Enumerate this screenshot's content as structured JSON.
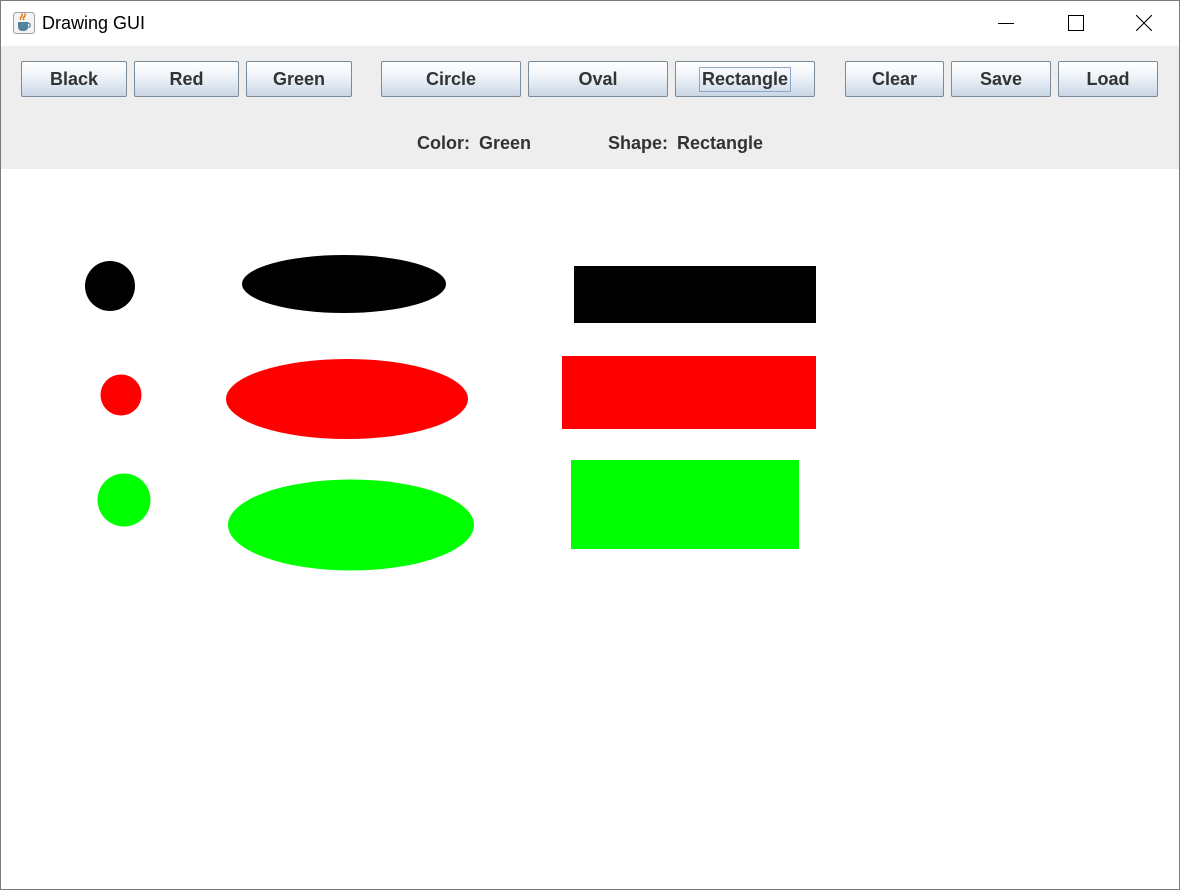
{
  "window": {
    "title": "Drawing GUI",
    "icon": "java-cup-icon",
    "controls": [
      "minimize-icon",
      "maximize-icon",
      "close-icon"
    ]
  },
  "toolbar": {
    "color_buttons": [
      "Black",
      "Red",
      "Green"
    ],
    "shape_buttons": [
      "Circle",
      "Oval",
      "Rectangle"
    ],
    "action_buttons": [
      "Clear",
      "Save",
      "Load"
    ],
    "focused_button": "Rectangle"
  },
  "status": {
    "color_label": "Color:",
    "color_value": "Green",
    "shape_label": "Shape:",
    "shape_value": "Rectangle"
  },
  "colors": {
    "Black": "#000000",
    "Red": "#ff0000",
    "Green": "#00ff00"
  },
  "drawn_shapes": [
    {
      "shape": "Circle",
      "color": "Black"
    },
    {
      "shape": "Oval",
      "color": "Black"
    },
    {
      "shape": "Rectangle",
      "color": "Black"
    },
    {
      "shape": "Circle",
      "color": "Red"
    },
    {
      "shape": "Oval",
      "color": "Red"
    },
    {
      "shape": "Rectangle",
      "color": "Red"
    },
    {
      "shape": "Circle",
      "color": "Green"
    },
    {
      "shape": "Oval",
      "color": "Green"
    },
    {
      "shape": "Rectangle",
      "color": "Green"
    }
  ]
}
